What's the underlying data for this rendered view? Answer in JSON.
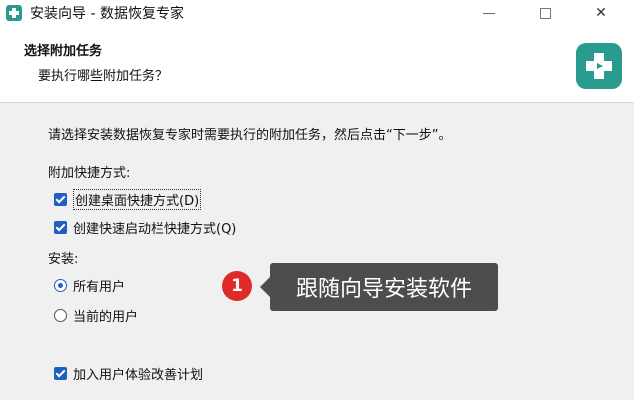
{
  "window": {
    "title": "安装向导 - 数据恢复专家",
    "controls": {
      "minimize_icon": "minimize-icon",
      "maximize_icon": "maximize-icon",
      "close_label": "✕"
    }
  },
  "header": {
    "title": "选择附加任务",
    "subtitle": "要执行哪些附加任务？"
  },
  "body": {
    "intro": "请选择安装数据恢复专家时需要执行的附加任务，然后点击“下一步”。",
    "shortcuts_label": "附加快捷方式:",
    "shortcuts": [
      {
        "label": "创建桌面快捷方式(D)",
        "checked": true
      },
      {
        "label": "创建快速启动栏快捷方式(Q)",
        "checked": true
      }
    ],
    "install_label": "安装:",
    "install_options": [
      {
        "label": "所有用户",
        "selected": true
      },
      {
        "label": "当前的用户",
        "selected": false
      }
    ],
    "ux_program": {
      "label": "加入用户体验改善计划",
      "checked": true
    }
  },
  "annotation": {
    "number": "1",
    "text": "跟随向导安装软件"
  },
  "colors": {
    "accent": "#1f5fbf",
    "brand": "#2a9b8f",
    "badge": "#e02a2a",
    "bubble": "#4d4d4d"
  }
}
